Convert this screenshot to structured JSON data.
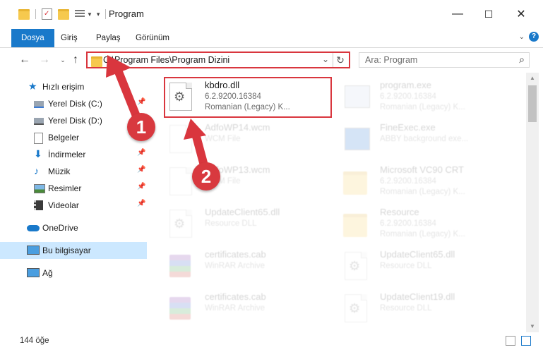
{
  "window": {
    "title": "Program",
    "controls": {
      "minimize": "—",
      "maximize": "☐",
      "close": "✕"
    }
  },
  "ribbon": {
    "tabs": [
      {
        "label": "Dosya",
        "active": true
      },
      {
        "label": "Giriş"
      },
      {
        "label": "Paylaş"
      },
      {
        "label": "Görünüm"
      }
    ]
  },
  "address_bar": {
    "path": "C:\\Program Files\\Program Dizini",
    "search_placeholder": "Ara: Program"
  },
  "nav_pane": {
    "items": [
      {
        "label": "Hızlı erişim",
        "icon": "star-icon"
      },
      {
        "label": "Yerel Disk (C:)",
        "icon": "drive-icon",
        "pinned": true
      },
      {
        "label": "Yerel Disk (D:)",
        "icon": "drive-icon"
      },
      {
        "label": "Belgeler",
        "icon": "documents-icon"
      },
      {
        "label": "İndirmeler",
        "icon": "download-icon",
        "pinned": true
      },
      {
        "label": "Müzik",
        "icon": "music-icon",
        "pinned": true
      },
      {
        "label": "Resimler",
        "icon": "pictures-icon",
        "pinned": true
      },
      {
        "label": "Videolar",
        "icon": "videos-icon",
        "pinned": true
      },
      {
        "label": "OneDrive",
        "icon": "cloud-icon"
      },
      {
        "label": "Bu bilgisayar",
        "icon": "computer-icon",
        "selected": true
      },
      {
        "label": "Ağ",
        "icon": "network-icon"
      }
    ]
  },
  "files": [
    {
      "name": "kbdro.dll",
      "line2": "6.2.9200.16384",
      "line3": "Romanian (Legacy) K...",
      "icon": "dll-gear-icon",
      "highlighted": true
    },
    {
      "name": "program.exe",
      "line2": "6.2.9200.16384",
      "line3": "Romanian (Legacy) K...",
      "icon": "exe-icon"
    },
    {
      "name": "AdfoWP14.wcm",
      "line2": "WCM File",
      "line3": "",
      "icon": "blank-file-icon"
    },
    {
      "name": "FineExec.exe",
      "line2": "ABBY background exe...",
      "line3": "",
      "icon": "window-exe-icon"
    },
    {
      "name": "AdfoWP13.wcm",
      "line2": "WCM File",
      "line3": "",
      "icon": "blank-file-icon"
    },
    {
      "name": "Microsoft VC90 CRT",
      "line2": "6.2.9200.16384",
      "line3": "Romanian (Legacy) K...",
      "icon": "folder-icon"
    },
    {
      "name": "UpdateClient65.dll",
      "line2": "Resource DLL",
      "line3": "",
      "icon": "dll-gear-icon"
    },
    {
      "name": "Resource",
      "line2": "6.2.9200.16384",
      "line3": "Romanian (Legacy) K...",
      "icon": "folder-icon"
    },
    {
      "name": "certificates.cab",
      "line2": "WinRAR Archive",
      "line3": "",
      "icon": "winrar-icon"
    },
    {
      "name": "UpdateClient65.dll",
      "line2": "Resource DLL",
      "line3": "",
      "icon": "dll-gear-icon"
    },
    {
      "name": "certificates.cab",
      "line2": "WinRAR Archive",
      "line3": "",
      "icon": "winrar-icon"
    },
    {
      "name": "UpdateClient19.dll",
      "line2": "Resource DLL",
      "line3": "",
      "icon": "dll-gear-icon"
    }
  ],
  "status_bar": {
    "item_count": "144 öğe"
  },
  "annotations": {
    "step1": "1",
    "step2": "2"
  },
  "colors": {
    "accent": "#1979ca",
    "highlight_red": "#d9363e",
    "selection": "#cce8ff"
  }
}
